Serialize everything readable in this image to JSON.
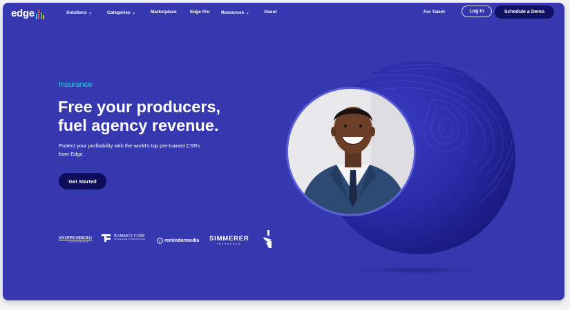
{
  "nav": {
    "logo_text": "edge",
    "items": [
      {
        "label": "Solutions",
        "has_dropdown": true
      },
      {
        "label": "Categories",
        "has_dropdown": true
      },
      {
        "label": "Marketplace",
        "has_dropdown": false
      },
      {
        "label": "Edge Pro",
        "has_dropdown": false
      },
      {
        "label": "Resources",
        "has_dropdown": true
      },
      {
        "label": "About",
        "has_dropdown": false
      }
    ],
    "for_talent": "For Talent",
    "login": "Log In",
    "demo": "Schedule a Demo"
  },
  "hero": {
    "eyebrow": "Insurance",
    "headline_line1": "Free your producers,",
    "headline_line2": "fuel agency revenue.",
    "subtext_line1": "Protect your profitability with the world’s top pre-trained CSRs",
    "subtext_line2": "from Edge.",
    "cta": "Get Started"
  },
  "partners": [
    {
      "name": "SNIPPENBERG",
      "sub": "INSURANCE"
    },
    {
      "name": "RAMMCY CORP",
      "sub": "INSURANCE CORPORATION"
    },
    {
      "name": "remindermedia"
    },
    {
      "name": "SIMMERER",
      "sub": "INSURANCE"
    }
  ],
  "colors": {
    "background": "#3638b0",
    "accent_cyan": "#2fd6e0",
    "button_dark": "#0d0d5c",
    "logo_bars": [
      "#2fd6e0",
      "#e8523c",
      "#40c26a",
      "#f3b23a"
    ]
  }
}
